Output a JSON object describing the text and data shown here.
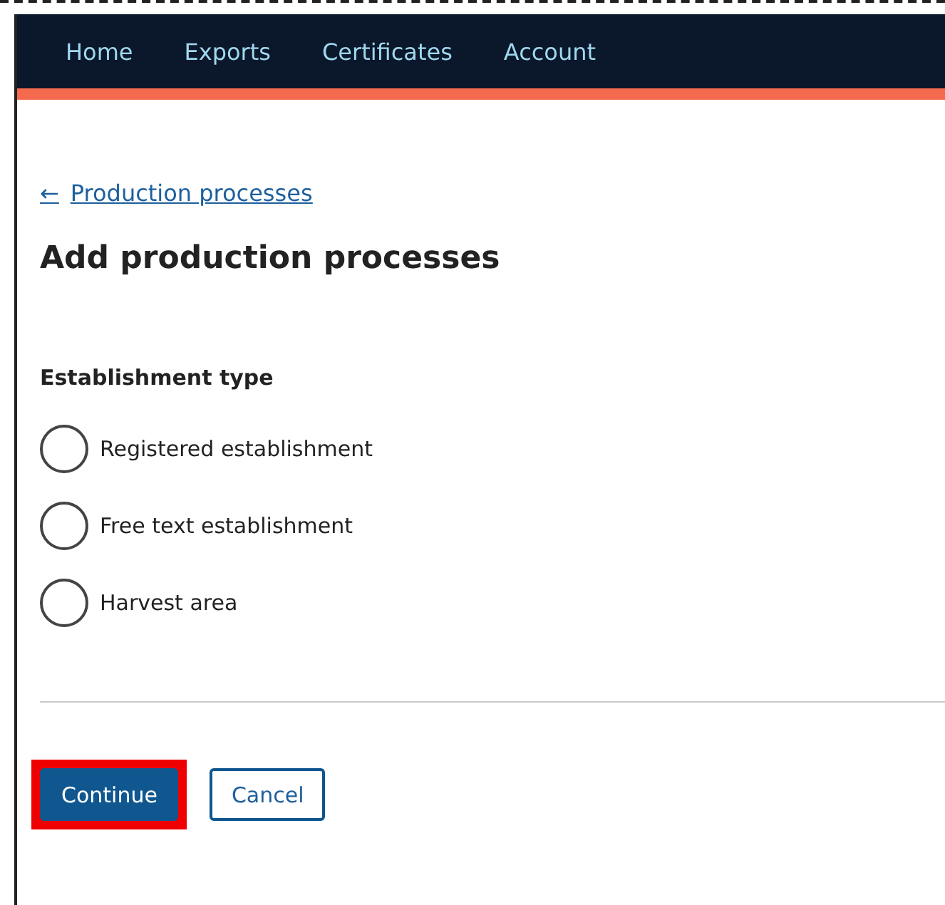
{
  "nav": {
    "items": [
      {
        "label": "Home"
      },
      {
        "label": "Exports"
      },
      {
        "label": "Certificates"
      },
      {
        "label": "Account"
      }
    ]
  },
  "back_link": {
    "arrow": "←",
    "label": "Production processes"
  },
  "heading": "Add production processes",
  "establishment_type": {
    "legend": "Establishment type",
    "options": [
      {
        "label": "Registered establishment",
        "selected": false
      },
      {
        "label": "Free text establishment",
        "selected": false
      },
      {
        "label": "Harvest area",
        "selected": false
      }
    ]
  },
  "buttons": [
    {
      "label": "Continue",
      "kind": "primary",
      "highlighted": true
    },
    {
      "label": "Cancel",
      "kind": "secondary",
      "highlighted": false
    }
  ]
}
